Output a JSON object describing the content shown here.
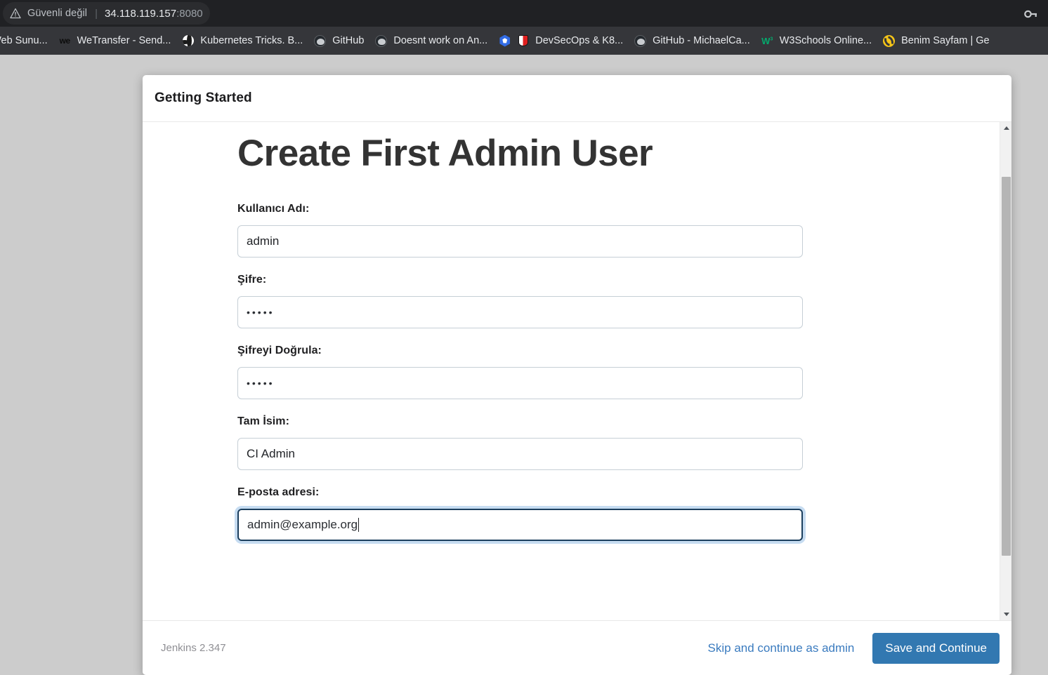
{
  "browser": {
    "security_warning": "Güvenli değil",
    "separator": "|",
    "url_host": "34.118.119.157",
    "url_port": ":8080",
    "warning_icon": "warning-triangle-icon",
    "password_manager_icon": "key-icon",
    "bookmarks": [
      {
        "label": "e Web Sunu...",
        "icon": "globe-icon"
      },
      {
        "label": "WeTransfer - Send...",
        "icon": "wetransfer-icon"
      },
      {
        "label": "Kubernetes Tricks. B...",
        "icon": "globe-icon"
      },
      {
        "label": "GitHub",
        "icon": "github-icon"
      },
      {
        "label": "Doesnt work on An...",
        "icon": "github-icon"
      },
      {
        "label": "DevSecOps & K8...",
        "icon": "kubernetes-icon"
      },
      {
        "label": "GitHub - MichaelCa...",
        "icon": "github-icon"
      },
      {
        "label": "W3Schools Online...",
        "icon": "w3schools-icon"
      },
      {
        "label": "Benim Sayfam | Ge",
        "icon": "swirl-icon"
      }
    ]
  },
  "dialog": {
    "header_title": "Getting Started",
    "page_heading": "Create First Admin User",
    "fields": [
      {
        "label": "Kullanıcı Adı:",
        "value": "admin",
        "type": "text",
        "name": "username",
        "focused": false
      },
      {
        "label": "Şifre:",
        "value": "•••••",
        "type": "password",
        "name": "password",
        "focused": false
      },
      {
        "label": "Şifreyi Doğrula:",
        "value": "•••••",
        "type": "password",
        "name": "confirm-password",
        "focused": false
      },
      {
        "label": "Tam İsim:",
        "value": "CI Admin",
        "type": "text",
        "name": "full-name",
        "focused": false
      },
      {
        "label": "E-posta adresi:",
        "value": "admin@example.org",
        "type": "email",
        "name": "email",
        "focused": true
      }
    ],
    "footer": {
      "version": "Jenkins 2.347",
      "skip_label": "Skip and continue as admin",
      "save_label": "Save and Continue"
    },
    "scrollbar": {
      "up_arrow_icon": "chevron-up-icon",
      "down_arrow_icon": "chevron-down-icon"
    }
  },
  "colors": {
    "accent": "#3278b1",
    "link": "#3a7bbf",
    "page_background": "#cccccc",
    "chrome_dark": "#202124",
    "bookmarks_bar": "#35363a",
    "focus_ring": "#c6dcf1"
  }
}
